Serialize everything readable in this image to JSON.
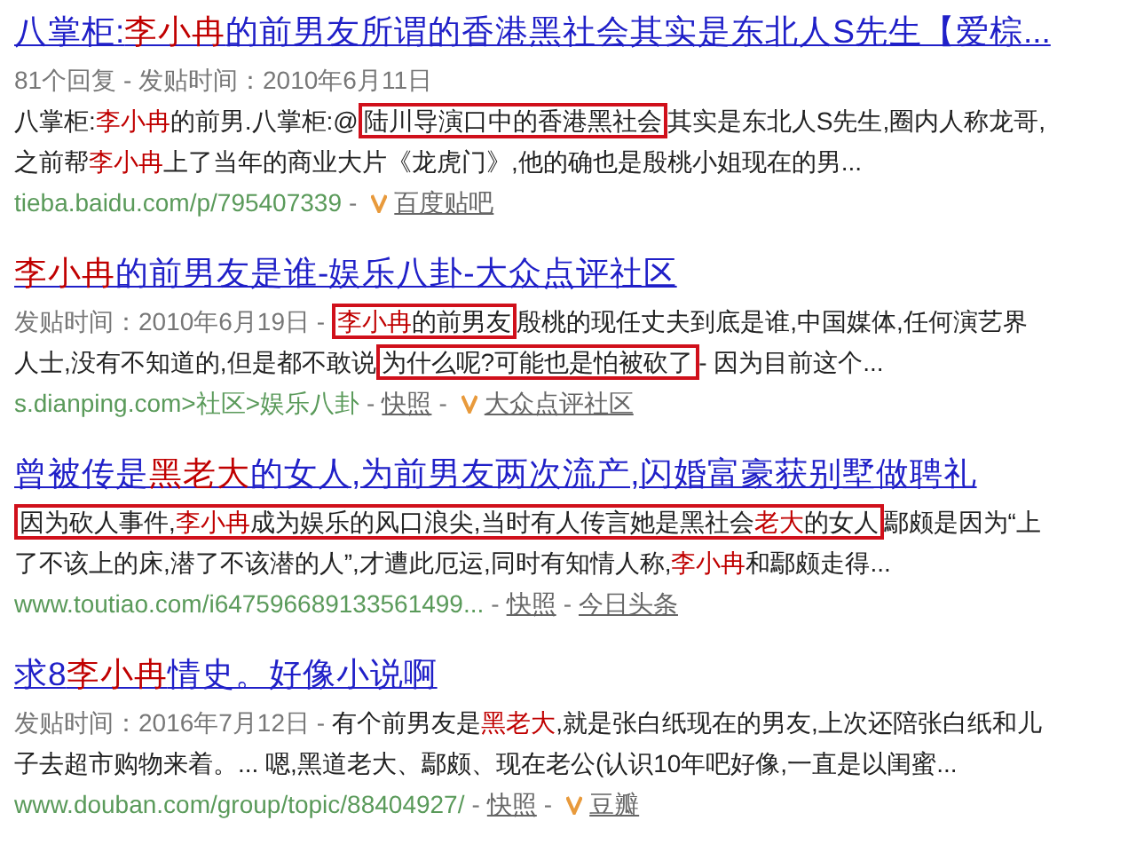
{
  "separator": "-",
  "results": [
    {
      "title": [
        {
          "text": "八掌柜:",
          "hl": false
        },
        {
          "text": "李小冉",
          "hl": true
        },
        {
          "text": "的前男友所谓的香港黑社会其实是东北人S先生【爱棕...",
          "hl": false
        }
      ],
      "lines": [
        [
          {
            "kind": "meta",
            "runs": [
              {
                "text": "81个回复 - 发贴时间：2010年6月11日",
                "hl": false
              }
            ]
          }
        ],
        [
          {
            "kind": "text",
            "runs": [
              {
                "text": "八掌柜:",
                "hl": false
              },
              {
                "text": "李小冉",
                "hl": true
              },
              {
                "text": "的前男.八掌柜:@",
                "hl": false
              }
            ]
          },
          {
            "kind": "boxed",
            "runs": [
              {
                "text": "陆川导演口中的香港黑社会",
                "hl": false
              }
            ]
          },
          {
            "kind": "text",
            "runs": [
              {
                "text": "其实是东北人S先生,圈内人称龙哥,",
                "hl": false
              }
            ]
          }
        ],
        [
          {
            "kind": "text",
            "runs": [
              {
                "text": "之前帮",
                "hl": false
              },
              {
                "text": "李小冉",
                "hl": true
              },
              {
                "text": "上了当年的商业大片《龙虎门》,他的确也是殷桃小姐现在的男...",
                "hl": false
              }
            ]
          }
        ]
      ],
      "url": "tieba.baidu.com/p/795407339",
      "links": [
        {
          "text": "百度贴吧",
          "verified": true
        }
      ]
    },
    {
      "title": [
        {
          "text": "李小冉",
          "hl": true
        },
        {
          "text": "的前男友是谁-娱乐八卦-大众点评社区",
          "hl": false
        }
      ],
      "lines": [
        [
          {
            "kind": "meta",
            "runs": [
              {
                "text": "发贴时间：2010年6月19日 -",
                "hl": false
              }
            ]
          },
          {
            "kind": "boxed",
            "runs": [
              {
                "text": "李小冉",
                "hl": true
              },
              {
                "text": "的前男友",
                "hl": false
              }
            ]
          },
          {
            "kind": "text",
            "runs": [
              {
                "text": "殷桃的现任丈夫到底是谁,中国媒体,任何演艺界",
                "hl": false
              }
            ]
          }
        ],
        [
          {
            "kind": "text",
            "runs": [
              {
                "text": "人士,没有不知道的,但是都不敢说",
                "hl": false
              }
            ]
          },
          {
            "kind": "boxed",
            "runs": [
              {
                "text": "为什么呢?可能也是怕被砍了",
                "hl": false
              }
            ]
          },
          {
            "kind": "text",
            "runs": [
              {
                "text": "- 因为目前这个...",
                "hl": false
              }
            ]
          }
        ]
      ],
      "url": "s.dianping.com>社区>娱乐八卦",
      "links": [
        {
          "text": "快照",
          "verified": false
        },
        {
          "text": "大众点评社区",
          "verified": true
        }
      ]
    },
    {
      "title": [
        {
          "text": "曾被传是",
          "hl": false
        },
        {
          "text": "黑老大",
          "hl": true
        },
        {
          "text": "的女人,为前男友两次流产,闪婚富豪获别墅做聘礼",
          "hl": false
        }
      ],
      "lines": [
        [
          {
            "kind": "boxed",
            "runs": [
              {
                "text": "因为砍人事件,",
                "hl": false
              },
              {
                "text": "李小冉",
                "hl": true
              },
              {
                "text": "成为娱乐的风口浪尖,当时有人传言她是黑社会",
                "hl": false
              },
              {
                "text": "老大",
                "hl": true
              },
              {
                "text": "的女人",
                "hl": false
              }
            ]
          },
          {
            "kind": "text",
            "runs": [
              {
                "text": "鄢颇是因为“上",
                "hl": false
              }
            ]
          }
        ],
        [
          {
            "kind": "text",
            "runs": [
              {
                "text": "了不该上的床,潜了不该潜的人”,才遭此厄运,同时有知情人称,",
                "hl": false
              },
              {
                "text": "李小冉",
                "hl": true
              },
              {
                "text": "和鄢颇走得...",
                "hl": false
              }
            ]
          }
        ]
      ],
      "url": "www.toutiao.com/i647596689133561499...",
      "links": [
        {
          "text": "快照",
          "verified": false
        },
        {
          "text": "今日头条",
          "verified": false
        }
      ]
    },
    {
      "title": [
        {
          "text": "求8",
          "hl": false
        },
        {
          "text": "李小冉",
          "hl": true
        },
        {
          "text": "情史。好像小说啊",
          "hl": false
        }
      ],
      "lines": [
        [
          {
            "kind": "meta",
            "runs": [
              {
                "text": "发贴时间：2016年7月12日 -",
                "hl": false
              }
            ]
          },
          {
            "kind": "text",
            "runs": [
              {
                "text": "有个前男友是",
                "hl": false
              },
              {
                "text": "黑老大",
                "hl": true
              },
              {
                "text": ",就是张白纸现在的男友,上次还陪张白纸和儿",
                "hl": false
              }
            ]
          }
        ],
        [
          {
            "kind": "text",
            "runs": [
              {
                "text": "子去超市购物来着。... 嗯,黑道老大、鄢颇、现在老公(认识10年吧好像,一直是以闺蜜...",
                "hl": false
              }
            ]
          }
        ]
      ],
      "url": "www.douban.com/group/topic/88404927/",
      "links": [
        {
          "text": "快照",
          "verified": false
        },
        {
          "text": "豆瓣",
          "verified": true
        }
      ]
    }
  ]
}
